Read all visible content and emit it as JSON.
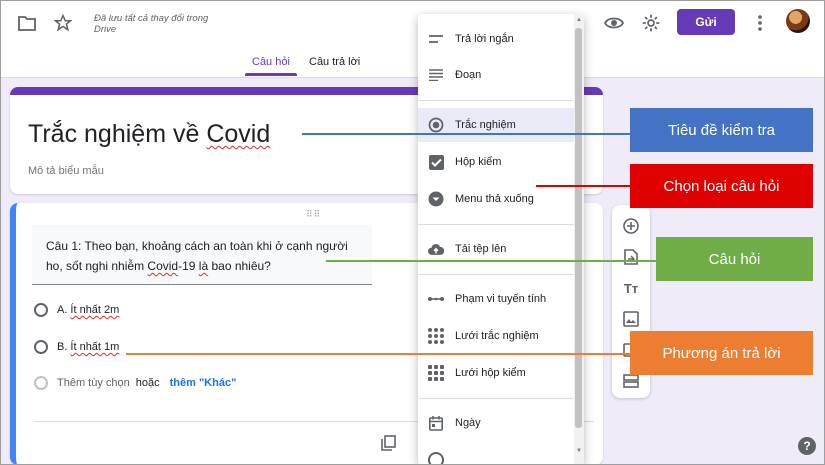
{
  "header": {
    "saved_status": "Đã lưu tất cả thay đổi trong Drive",
    "send_label": "Gửi",
    "tabs": [
      {
        "label": "Câu hỏi",
        "active": true
      },
      {
        "label": "Câu trả lời",
        "active": false
      }
    ],
    "icons": [
      "folder-icon",
      "star-icon",
      "preview-eye-icon",
      "settings-gear-icon",
      "more-vert-icon",
      "user-avatar"
    ],
    "accent_color": "#673ab7"
  },
  "form": {
    "title_prefix": "Trắc nghiệm về",
    "title_word": "Covid",
    "description_placeholder": "Mô tả biểu mẫu"
  },
  "question": {
    "text_line1": "Câu 1: Theo bạn, khoảng cách an toàn khi ở cạnh người",
    "text_line2_a": "ho, sốt nghi nhiễm",
    "text_line2_b": "Covid",
    "text_line2_c": "-19",
    "text_line2_d": "là",
    "text_line2_e": "bao nhiêu?",
    "options": [
      {
        "prefix": "A.",
        "text": "Ít nhất 2m"
      },
      {
        "prefix": "B.",
        "text": "Ít nhất 1m"
      }
    ],
    "add_option": "Thêm tùy chọn",
    "or_text": "hoặc",
    "add_other": "thêm \"Khác\""
  },
  "type_menu": {
    "items": [
      {
        "label": "Trả lời ngắn",
        "icon": "short-answer-icon"
      },
      {
        "label": "Đoạn",
        "icon": "paragraph-icon"
      },
      {
        "label": "Trắc nghiệm",
        "icon": "radio-icon",
        "selected": true
      },
      {
        "label": "Hộp kiểm",
        "icon": "checkbox-icon"
      },
      {
        "label": "Menu thả xuống",
        "icon": "dropdown-icon"
      },
      {
        "label": "Tải tệp lên",
        "icon": "cloud-upload-icon"
      },
      {
        "label": "Phạm vi tuyến tính",
        "icon": "linear-scale-icon"
      },
      {
        "label": "Lưới trắc nghiệm",
        "icon": "multiple-choice-grid-icon"
      },
      {
        "label": "Lưới hộp kiểm",
        "icon": "checkbox-grid-icon"
      },
      {
        "label": "Ngày",
        "icon": "calendar-icon"
      }
    ]
  },
  "side_toolbar": {
    "icons": [
      "add-question-icon",
      "import-questions-icon",
      "add-title-icon",
      "add-image-icon",
      "add-video-icon",
      "add-section-icon"
    ]
  },
  "annotations": [
    {
      "label": "Tiêu đề kiểm tra",
      "bg": "#4472c4",
      "line": "#4472c4",
      "text_color": "#ffffff"
    },
    {
      "label": "Chọn loại câu hỏi",
      "bg": "#e00000",
      "line": "#e00000",
      "text_color": "#ffffff"
    },
    {
      "label": "Câu hỏi",
      "bg": "#70ad47",
      "line": "#70ad47",
      "text_color": "#ffffff"
    },
    {
      "label": "Phương án trả lời",
      "bg": "#ed7d31",
      "line": "#ed7d31",
      "text_color": "#ffffff"
    }
  ]
}
